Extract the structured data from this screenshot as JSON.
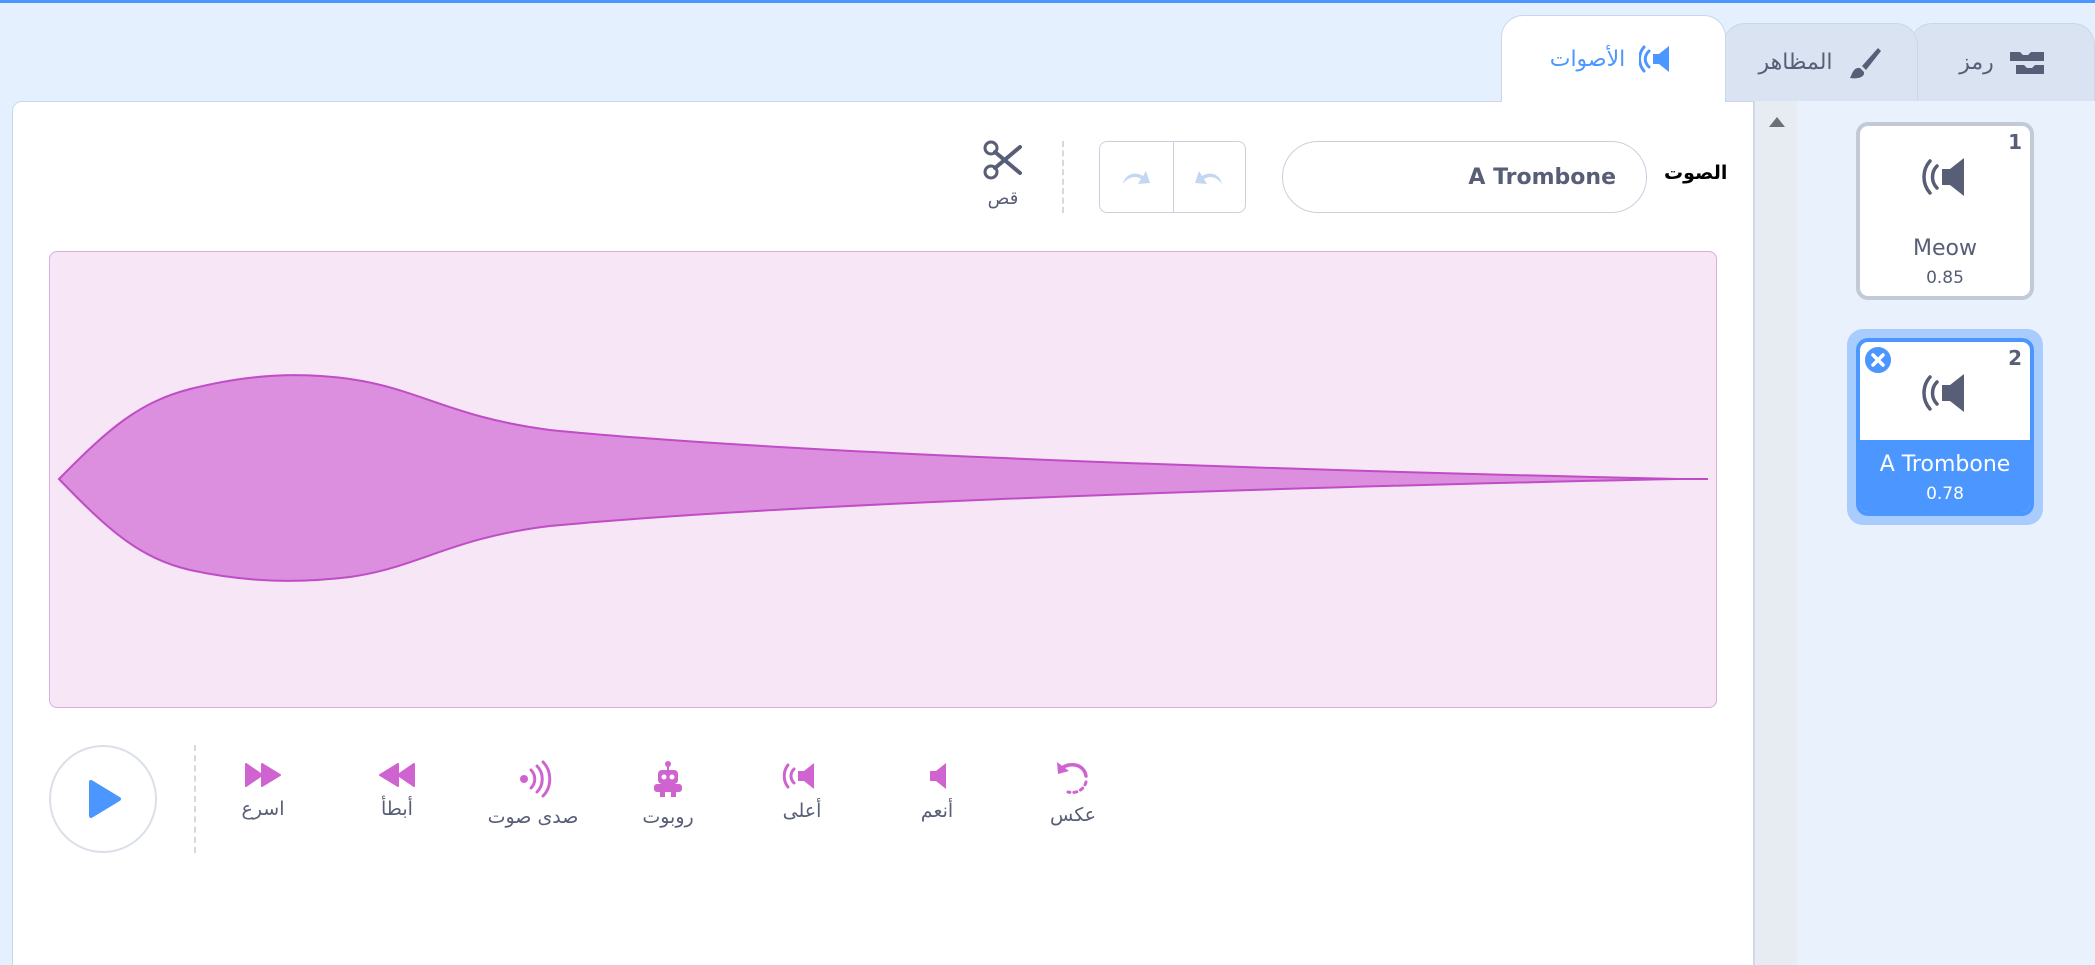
{
  "tabs": [
    {
      "label": "رمز",
      "icon": "code-blocks-icon"
    },
    {
      "label": "المظاهر",
      "icon": "paintbrush-icon"
    },
    {
      "label": "الأصوات",
      "icon": "speaker-icon",
      "active": true
    }
  ],
  "toolbar": {
    "sound_label": "الصوت",
    "sound_name": "A Trombone",
    "undo_icon": "undo-icon",
    "redo_icon": "redo-icon",
    "trim_label": "قص"
  },
  "effects": [
    {
      "label": "اسرع",
      "icon": "faster-icon"
    },
    {
      "label": "أبطأ",
      "icon": "slower-icon"
    },
    {
      "label": "صدى صوت",
      "icon": "echo-icon"
    },
    {
      "label": "روبوت",
      "icon": "robot-icon"
    },
    {
      "label": "أعلى",
      "icon": "louder-icon"
    },
    {
      "label": "أنعم",
      "icon": "softer-icon"
    },
    {
      "label": "عكس",
      "icon": "reverse-icon"
    }
  ],
  "sounds": [
    {
      "index": "1",
      "name": "Meow",
      "duration": "0.85",
      "selected": false
    },
    {
      "index": "2",
      "name": "A Trombone",
      "duration": "0.78",
      "selected": true
    }
  ],
  "colors": {
    "accent": "#4c97ff",
    "sound_effect": "#cf63cf",
    "wave_fill": "#dc8fdf",
    "wave_bg": "#f6e6f6"
  }
}
